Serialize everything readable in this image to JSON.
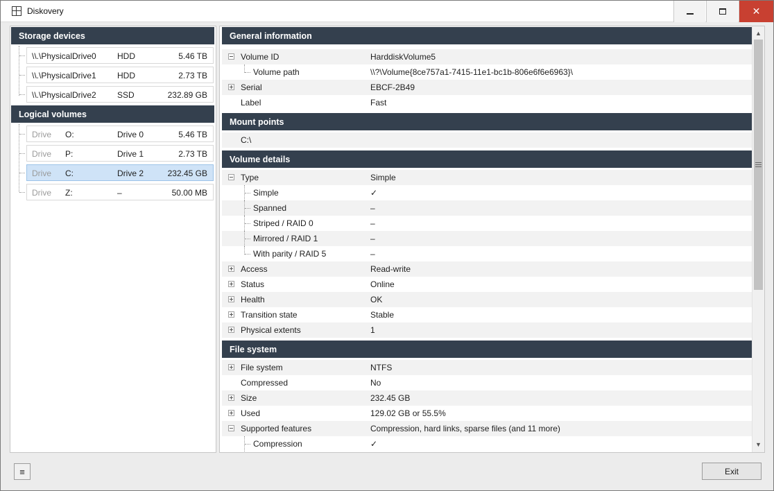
{
  "window": {
    "title": "Diskovery"
  },
  "storage": {
    "header": "Storage devices",
    "devices": [
      {
        "name": "\\\\.\\PhysicalDrive0",
        "type": "HDD",
        "size": "5.46 TB"
      },
      {
        "name": "\\\\.\\PhysicalDrive1",
        "type": "HDD",
        "size": "2.73 TB"
      },
      {
        "name": "\\\\.\\PhysicalDrive2",
        "type": "SSD",
        "size": "232.89 GB"
      }
    ]
  },
  "volumes": {
    "header": "Logical volumes",
    "selected_index": 2,
    "items": [
      {
        "kind": "Drive",
        "letter": "O:",
        "name": "Drive 0",
        "size": "5.46 TB"
      },
      {
        "kind": "Drive",
        "letter": "P:",
        "name": "Drive 1",
        "size": "2.73 TB"
      },
      {
        "kind": "Drive",
        "letter": "C:",
        "name": "Drive 2",
        "size": "232.45 GB"
      },
      {
        "kind": "Drive",
        "letter": "Z:",
        "name": "–",
        "size": "50.00 MB"
      }
    ]
  },
  "details": {
    "general": {
      "header": "General information",
      "volume_id": {
        "key": "Volume ID",
        "value": "HarddiskVolume5"
      },
      "volume_path": {
        "key": "Volume path",
        "value": "\\\\?\\Volume{8ce757a1-7415-11e1-bc1b-806e6f6e6963}\\"
      },
      "serial": {
        "key": "Serial",
        "value": "EBCF-2B49"
      },
      "label": {
        "key": "Label",
        "value": "Fast"
      }
    },
    "mount": {
      "header": "Mount points",
      "value": "C:\\"
    },
    "volume_details": {
      "header": "Volume details",
      "type": {
        "key": "Type",
        "value": "Simple"
      },
      "simple": {
        "key": "Simple",
        "value": "✓"
      },
      "spanned": {
        "key": "Spanned",
        "value": "–"
      },
      "striped": {
        "key": "Striped / RAID 0",
        "value": "–"
      },
      "mirrored": {
        "key": "Mirrored / RAID 1",
        "value": "–"
      },
      "parity": {
        "key": "With parity / RAID 5",
        "value": "–"
      },
      "access": {
        "key": "Access",
        "value": "Read-write"
      },
      "status": {
        "key": "Status",
        "value": "Online"
      },
      "health": {
        "key": "Health",
        "value": "OK"
      },
      "transition": {
        "key": "Transition state",
        "value": "Stable"
      },
      "extents": {
        "key": "Physical extents",
        "value": "1"
      }
    },
    "filesystem": {
      "header": "File system",
      "fs": {
        "key": "File system",
        "value": "NTFS"
      },
      "compressed": {
        "key": "Compressed",
        "value": "No"
      },
      "size": {
        "key": "Size",
        "value": "232.45 GB"
      },
      "used": {
        "key": "Used",
        "value": "129.02 GB  or  55.5%"
      },
      "features": {
        "key": "Supported features",
        "value": "Compression, hard links, sparse files (and 11 more)"
      },
      "compression": {
        "key": "Compression",
        "value": "✓"
      }
    }
  },
  "footer": {
    "menu_icon": "≡",
    "exit_label": "Exit"
  },
  "scrollbar": {
    "up_icon": "▲",
    "down_icon": "▼"
  },
  "window_controls": {
    "close_icon": "✕"
  }
}
